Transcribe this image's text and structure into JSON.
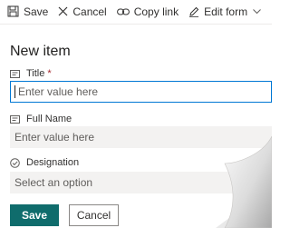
{
  "toolbar": {
    "save_label": "Save",
    "cancel_label": "Cancel",
    "copy_link_label": "Copy link",
    "edit_form_label": "Edit form"
  },
  "form": {
    "heading": "New item",
    "fields": [
      {
        "label": "Title",
        "required_mark": "*",
        "placeholder": "Enter value here",
        "icon": "text-field-icon"
      },
      {
        "label": "Full Name",
        "placeholder": "Enter value here",
        "icon": "text-field-icon"
      },
      {
        "label": "Designation",
        "placeholder": "Select an option",
        "icon": "choice-icon"
      }
    ]
  },
  "actions": {
    "save_label": "Save",
    "cancel_label": "Cancel"
  },
  "colors": {
    "accent": "#0f6c6c",
    "focus_border": "#0078d4",
    "required": "#a4262c"
  }
}
